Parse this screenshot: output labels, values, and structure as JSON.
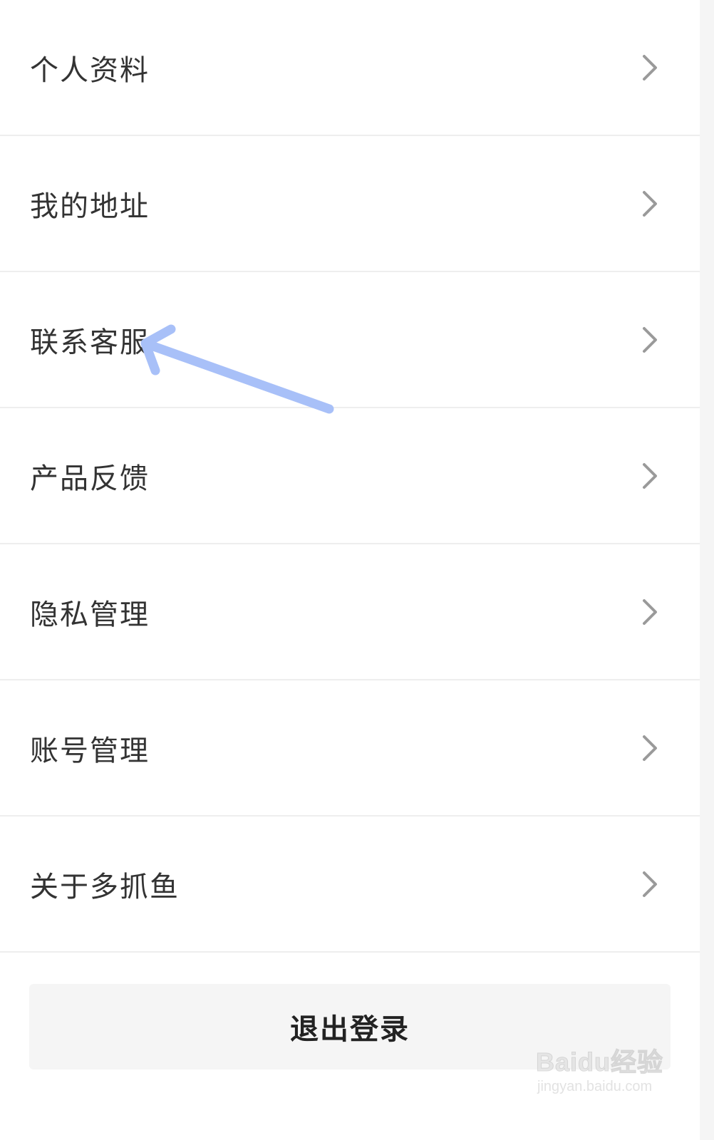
{
  "menu": {
    "items": [
      {
        "label": "个人资料"
      },
      {
        "label": "我的地址"
      },
      {
        "label": "联系客服"
      },
      {
        "label": "产品反馈"
      },
      {
        "label": "隐私管理"
      },
      {
        "label": "账号管理"
      },
      {
        "label": "关于多抓鱼"
      }
    ]
  },
  "logout": {
    "label": "退出登录"
  },
  "annotation": {
    "color": "#a8c0f8"
  },
  "watermark": {
    "logo": "Baidu经验",
    "url": "jingyan.baidu.com"
  },
  "icons": {
    "chevron": "chevron-right-icon",
    "arrow": "annotation-arrow"
  }
}
